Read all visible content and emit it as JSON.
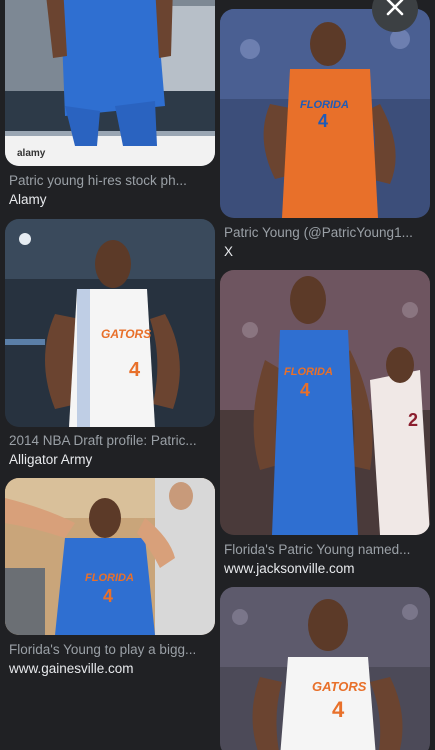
{
  "results": [
    {
      "caption": "Patric young hi-res stock ph...",
      "source": "Alamy",
      "watermark": "alamy"
    },
    {
      "caption": "Patric Young (@PatricYoung1...",
      "source": "X",
      "jersey_text": "FLORIDA",
      "jersey_number": "4"
    },
    {
      "caption": "2014 NBA Draft profile: Patric...",
      "source": "Alligator Army",
      "jersey_text": "GATORS",
      "jersey_number": "4"
    },
    {
      "caption": "Florida's Patric Young named...",
      "source": "www.jacksonville.com",
      "jersey_text": "FLORIDA",
      "jersey_number": "4",
      "opponent_number": "2"
    },
    {
      "caption": "Florida's Young to play a bigg...",
      "source": "www.gainesville.com",
      "jersey_text": "FLORIDA",
      "jersey_number": "4"
    },
    {
      "caption": "",
      "source": "",
      "jersey_text": "GATORS",
      "jersey_number": "4"
    }
  ],
  "colors": {
    "florida_blue": "#1f5bb8",
    "florida_orange": "#e8702a",
    "background": "#202124"
  },
  "icons": {
    "close": "close-icon"
  }
}
